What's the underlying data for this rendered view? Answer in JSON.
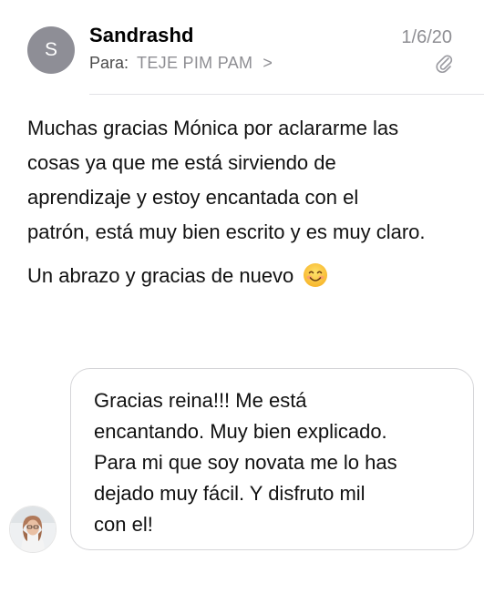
{
  "header": {
    "avatar_initial": "S",
    "sender": "Sandrashd",
    "to_label": "Para:",
    "to_value": "TEJE PIM PAM",
    "to_chevron": ">",
    "date": "1/6/20"
  },
  "message": {
    "lines": [
      "Muchas gracias Mónica por aclararme las",
      "cosas ya que me está sirviendo de",
      "aprendizaje y estoy encantada con el",
      "patrón, está muy bien escrito y es muy claro."
    ],
    "greeting": "Un abrazo y gracias de nuevo"
  },
  "reply": {
    "lines": [
      "Gracias reina!!! Me está",
      "encantando. Muy bien explicado.",
      "Para mi que soy novata me lo has",
      "dejado muy fácil. Y disfruto mil",
      "con el!"
    ]
  },
  "icons": {
    "attachment": "paperclip-icon",
    "emoji": "smiling-face-emoji",
    "reply_avatar": "user-photo-avatar"
  },
  "colors": {
    "avatar_bg": "#8e8e96",
    "secondary_text": "#8e8e93",
    "divider": "#e3e3e6",
    "bubble_border": "#d5d5d8"
  }
}
